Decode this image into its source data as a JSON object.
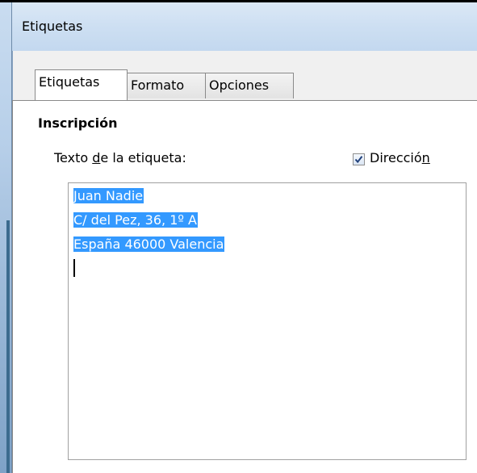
{
  "window": {
    "title": "Etiquetas"
  },
  "tabs": [
    {
      "label": "Etiquetas",
      "active": true
    },
    {
      "label": "Formato",
      "active": false
    },
    {
      "label": "Opciones",
      "active": false
    }
  ],
  "inscription": {
    "section_title": "Inscripción",
    "text_label_before": "Texto ",
    "text_label_accel": "d",
    "text_label_after": "e la etiqueta:",
    "address_checkbox": {
      "label_before": "Direcció",
      "label_accel": "n",
      "checked": true
    },
    "label_text_lines": [
      "Juan Nadie",
      "C/ del Pez, 36, 1º A",
      "España 46000 Valencia"
    ]
  },
  "colors": {
    "selection": "#3399ff",
    "titlebar": "#cddff2",
    "panel": "#ffffff",
    "dialog_bg": "#f0f0f0"
  },
  "icons": {
    "checkbox_check": "check-icon"
  }
}
